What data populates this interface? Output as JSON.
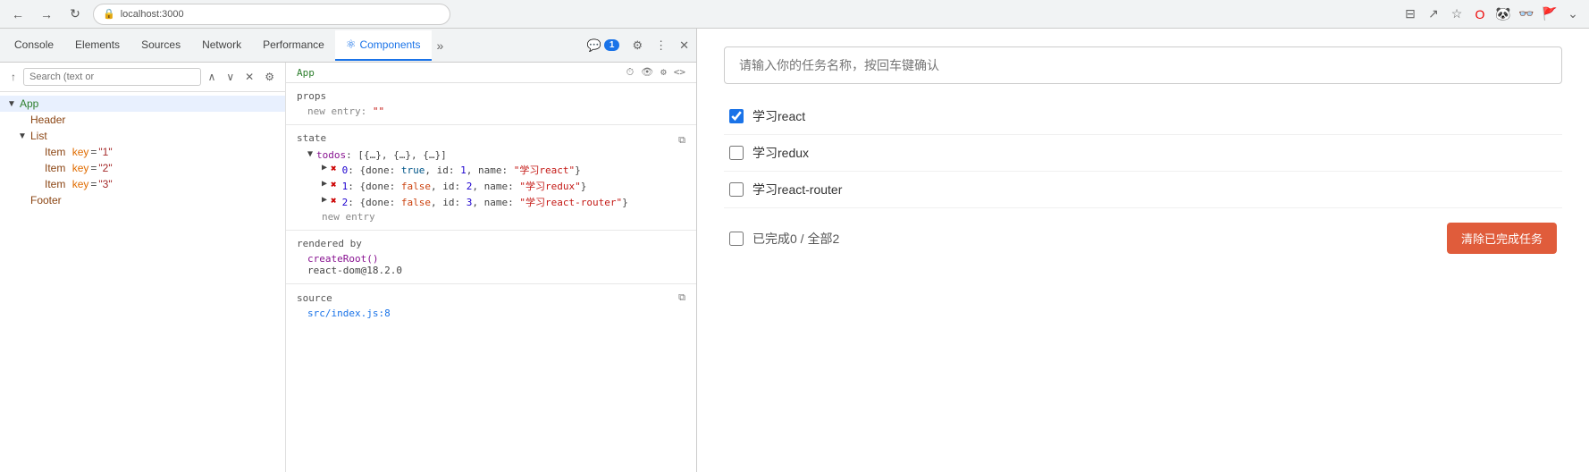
{
  "browser": {
    "url": "localhost:3000",
    "back_label": "←",
    "forward_label": "→",
    "refresh_label": "↻"
  },
  "devtools": {
    "tabs": [
      {
        "id": "console",
        "label": "Console",
        "active": false
      },
      {
        "id": "elements",
        "label": "Elements",
        "active": false
      },
      {
        "id": "sources",
        "label": "Sources",
        "active": false
      },
      {
        "id": "network",
        "label": "Network",
        "active": false
      },
      {
        "id": "performance",
        "label": "Performance",
        "active": false
      },
      {
        "id": "components",
        "label": "Components",
        "active": true
      }
    ],
    "tab_badge": "1",
    "more_tabs_icon": "»",
    "close_icon": "✕"
  },
  "component_tree": {
    "search_placeholder": "Search (text or",
    "toolbar_icon": "⚙",
    "app_label": "App",
    "selected_component": "App",
    "items": [
      {
        "id": "app",
        "label": "App",
        "indent": 0,
        "toggle": "▼",
        "is_app": true
      },
      {
        "id": "header",
        "label": "Header",
        "indent": 1,
        "toggle": ""
      },
      {
        "id": "list",
        "label": "List",
        "indent": 1,
        "toggle": "▼"
      },
      {
        "id": "item1",
        "label": "Item",
        "key_label": "key",
        "key_val": "\"1\"",
        "indent": 2,
        "toggle": ""
      },
      {
        "id": "item2",
        "label": "Item",
        "key_label": "key",
        "key_val": "\"2\"",
        "indent": 2,
        "toggle": ""
      },
      {
        "id": "item3",
        "label": "Item",
        "key_label": "key",
        "key_val": "\"3\"",
        "indent": 2,
        "toggle": ""
      },
      {
        "id": "footer",
        "label": "Footer",
        "indent": 1,
        "toggle": ""
      }
    ]
  },
  "props_panel": {
    "selected_name": "App",
    "icons": [
      "⏱",
      "👁",
      "⚙",
      "<>"
    ],
    "props_label": "props",
    "props_entry": "new entry: \"\"",
    "state_label": "state",
    "state_copy_icon": "⧉",
    "todos_line": "▼ todos: [{…}, {…}, {…}]",
    "todo_items": [
      {
        "index": 0,
        "toggle": "▶",
        "err_icon": "✖",
        "text": "{done: true, id: 1, name: \"学习react\"}"
      },
      {
        "index": 1,
        "toggle": "▶",
        "err_icon": "✖",
        "text": "{done: false, id: 2, name: \"学习redux\"}"
      },
      {
        "index": 2,
        "toggle": "▶",
        "err_icon": "✖",
        "text": "{done: false, id: 3, name: \"学习react-router\"}"
      }
    ],
    "new_entry_label": "new entry",
    "rendered_label": "rendered by",
    "rendered_items": [
      "createRoot()",
      "react-dom@18.2.0"
    ],
    "source_label": "source",
    "source_val": "src/index.js:8"
  },
  "app": {
    "input_placeholder": "请输入你的任务名称，按回车键确认",
    "tasks": [
      {
        "id": 1,
        "name": "学习react",
        "done": true
      },
      {
        "id": 2,
        "name": "学习redux",
        "done": false
      },
      {
        "id": 3,
        "name": "学习react-router",
        "done": false
      }
    ],
    "footer_stats": "已完成0 / 全部2",
    "clear_button_label": "清除已完成任务"
  }
}
